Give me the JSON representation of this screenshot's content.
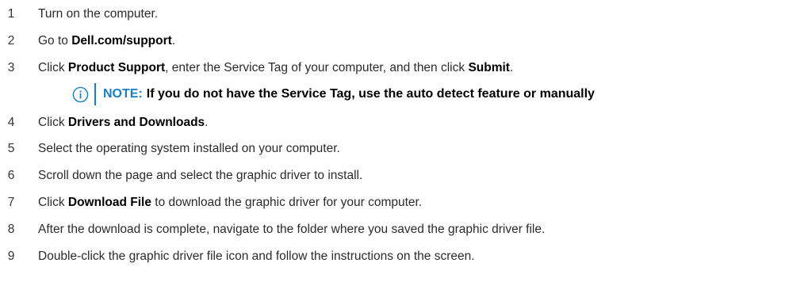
{
  "colors": {
    "note_accent": "#1a7fc1",
    "text": "#2b2b2b"
  },
  "steps": [
    {
      "num": "1",
      "parts": [
        {
          "t": "Turn on the computer."
        }
      ]
    },
    {
      "num": "2",
      "parts": [
        {
          "t": "Go to "
        },
        {
          "t": "Dell.com/support",
          "b": true
        },
        {
          "t": "."
        }
      ]
    },
    {
      "num": "3",
      "parts": [
        {
          "t": "Click "
        },
        {
          "t": "Product Support",
          "b": true
        },
        {
          "t": ", enter the Service Tag of your computer, and then click "
        },
        {
          "t": "Submit",
          "b": true
        },
        {
          "t": "."
        }
      ]
    },
    {
      "num": "4",
      "parts": [
        {
          "t": "Click "
        },
        {
          "t": "Drivers and Downloads",
          "b": true
        },
        {
          "t": "."
        }
      ]
    },
    {
      "num": "5",
      "parts": [
        {
          "t": "Select the operating system installed on your computer."
        }
      ]
    },
    {
      "num": "6",
      "parts": [
        {
          "t": "Scroll down the page and select the graphic driver to install."
        }
      ]
    },
    {
      "num": "7",
      "parts": [
        {
          "t": "Click "
        },
        {
          "t": "Download File",
          "b": true
        },
        {
          "t": " to download the graphic driver for your computer."
        }
      ]
    },
    {
      "num": "8",
      "parts": [
        {
          "t": "After the download is complete, navigate to the folder where you saved the graphic driver file."
        }
      ]
    },
    {
      "num": "9",
      "parts": [
        {
          "t": "Double-click the graphic driver file icon and follow the instructions on the screen."
        }
      ]
    }
  ],
  "note": {
    "icon": "info-icon",
    "label": "NOTE:",
    "text": "If you do not have the Service Tag, use the auto detect feature or manually"
  }
}
